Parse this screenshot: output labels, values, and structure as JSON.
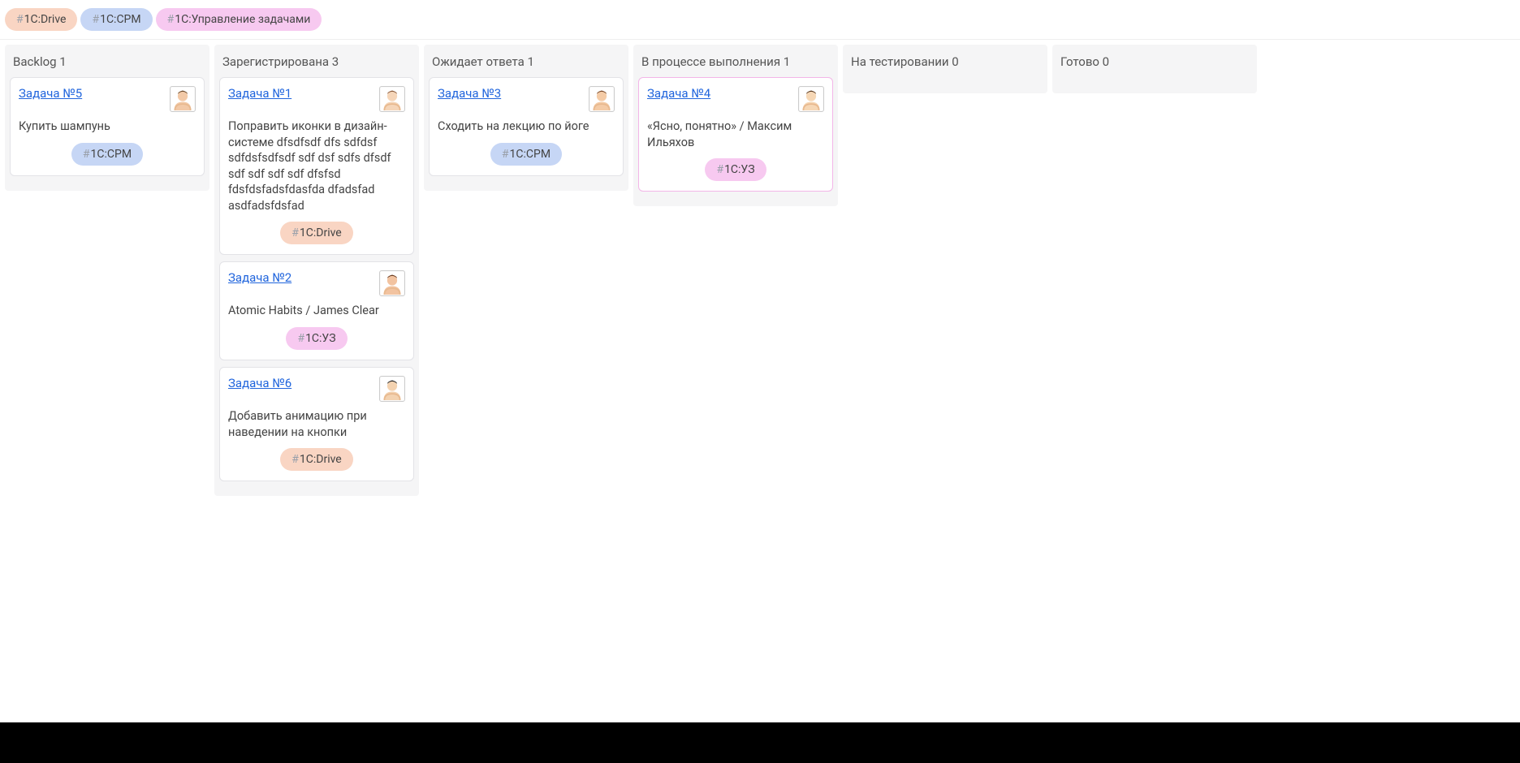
{
  "filters": [
    {
      "label": "1C:Drive",
      "color": "peach"
    },
    {
      "label": "1C:CPM",
      "color": "blue"
    },
    {
      "label": "1C:Управление задачами",
      "color": "pink"
    }
  ],
  "columns": [
    {
      "title": "Backlog",
      "count": 1,
      "cards": [
        {
          "link": "Задача №5",
          "desc": "Купить шампунь",
          "tag": {
            "label": "1C:CPM",
            "color": "blue"
          },
          "avatar": "m1",
          "selected": false
        }
      ]
    },
    {
      "title": "Зарегистрирована",
      "count": 3,
      "cards": [
        {
          "link": "Задача №1",
          "desc": "Поправить иконки в дизайн-системе dfsdfsdf dfs sdfdsf sdfdsfsdfsdf sdf dsf sdfs dfsdf sdf sdf sdf sdf dfsfsd fdsfdsfadsfdasfda dfadsfad asdfadsfdsfad",
          "tag": {
            "label": "1C:Drive",
            "color": "peach"
          },
          "avatar": "f1",
          "selected": false
        },
        {
          "link": "Задача №2",
          "desc": "Atomic Habits / James Clear",
          "tag": {
            "label": "1C:УЗ",
            "color": "pink"
          },
          "avatar": "f2",
          "selected": false
        },
        {
          "link": "Задача №6",
          "desc": "Добавить анимацию при наведении на кнопки",
          "tag": {
            "label": "1C:Drive",
            "color": "peach"
          },
          "avatar": "m2",
          "selected": false
        }
      ]
    },
    {
      "title": "Ожидает ответа",
      "count": 1,
      "cards": [
        {
          "link": "Задача №3",
          "desc": "Сходить на лекцию по йоге",
          "tag": {
            "label": "1C:CPM",
            "color": "blue"
          },
          "avatar": "f3",
          "selected": false
        }
      ]
    },
    {
      "title": "В процессе выполнения",
      "count": 1,
      "cards": [
        {
          "link": "Задача №4",
          "desc": "«Ясно, понятно» / Максим Ильяхов",
          "tag": {
            "label": "1C:УЗ",
            "color": "pink"
          },
          "avatar": "m3",
          "selected": true
        }
      ]
    },
    {
      "title": "На тестировании",
      "count": 0,
      "cards": []
    },
    {
      "title": "Готово",
      "count": 0,
      "cards": []
    }
  ],
  "colors": {
    "peach": "#f9d5c3",
    "blue": "#c6d6f5",
    "pink": "#f7c9f0"
  }
}
